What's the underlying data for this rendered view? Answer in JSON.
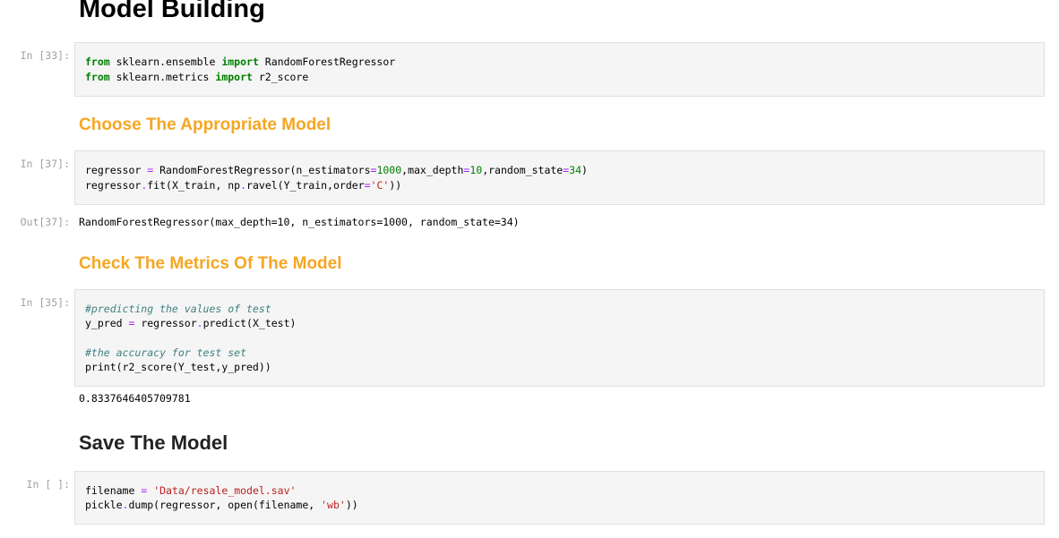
{
  "notebook": {
    "heading_model_building": "Model Building",
    "heading_choose": "Choose The Appropriate Model",
    "heading_check": "Check The Metrics Of The Model",
    "heading_save": "Save The Model",
    "cells": [
      {
        "prompt": "In [33]:",
        "lines": [
          "from sklearn.ensemble import RandomForestRegressor",
          "from sklearn.metrics import r2_score"
        ]
      },
      {
        "prompt": "In [37]:",
        "lines": [
          "regressor = RandomForestRegressor(n_estimators=1000,max_depth=10,random_state=34)",
          "regressor.fit(X_train, np.ravel(Y_train,order='C'))"
        ],
        "out_prompt": "Out[37]:",
        "output": "RandomForestRegressor(max_depth=10, n_estimators=1000, random_state=34)"
      },
      {
        "prompt": "In [35]:",
        "lines": [
          "#predicting the values of test",
          "y_pred = regressor.predict(X_test)",
          "",
          "#the accuracy for test set",
          "print(r2_score(Y_test,y_pred))"
        ],
        "output": "0.8337646405709781"
      },
      {
        "prompt": "In [ ]:",
        "lines": [
          "filename = 'Data/resale_model.sav'",
          "pickle.dump(regressor, open(filename, 'wb'))"
        ]
      }
    ]
  },
  "colors": {
    "heading_orange": "#f5a623",
    "keyword_green": "#008000",
    "string_red": "#ba2121",
    "comment_teal": "#408080",
    "operator_purple": "#aa22ff"
  }
}
